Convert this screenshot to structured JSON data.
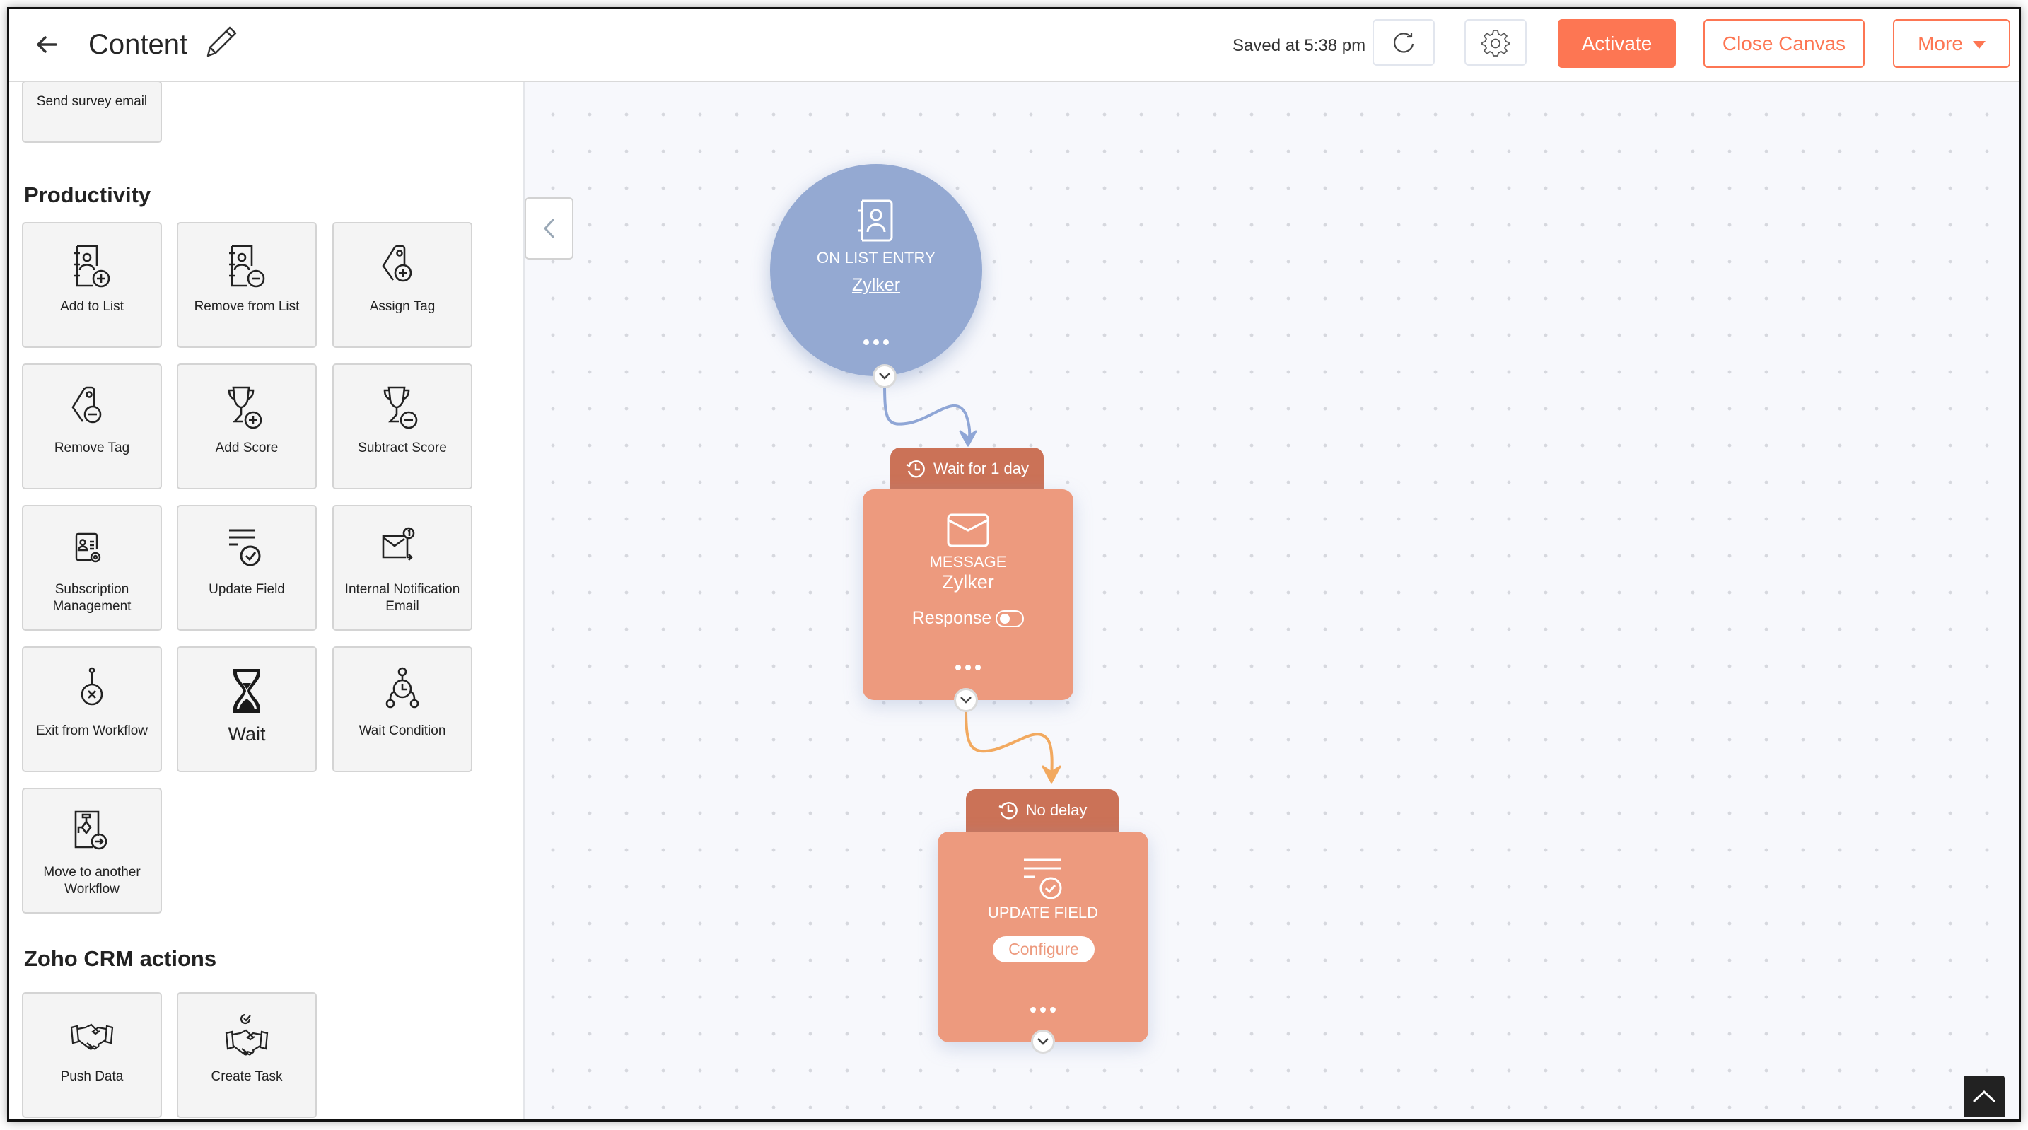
{
  "header": {
    "title": "Content",
    "saved_status": "Saved at 5:38 pm",
    "activate_label": "Activate",
    "close_canvas_label": "Close Canvas",
    "more_label": "More",
    "icons": {
      "back": "arrow-left-icon",
      "edit": "pencil-icon",
      "refresh": "refresh-icon",
      "settings": "gear-icon",
      "more_dropdown": "caret-down-icon"
    }
  },
  "sidebar": {
    "top_partial_tile": {
      "label": "Send survey email"
    },
    "sections": [
      {
        "title": "Productivity",
        "tiles": [
          {
            "label": "Add to List",
            "icon": "add-to-list-icon"
          },
          {
            "label": "Remove from List",
            "icon": "remove-from-list-icon"
          },
          {
            "label": "Assign Tag",
            "icon": "assign-tag-icon"
          },
          {
            "label": "Remove Tag",
            "icon": "remove-tag-icon"
          },
          {
            "label": "Add Score",
            "icon": "add-score-icon"
          },
          {
            "label": "Subtract Score",
            "icon": "subtract-score-icon"
          },
          {
            "label": "Subscription Management",
            "icon": "subscription-management-icon"
          },
          {
            "label": "Update Field",
            "icon": "update-field-icon"
          },
          {
            "label": "Internal Notification Email",
            "icon": "notification-email-icon"
          },
          {
            "label": "Exit from Workflow",
            "icon": "exit-workflow-icon"
          },
          {
            "label": "Wait",
            "icon": "hourglass-icon"
          },
          {
            "label": "Wait Condition",
            "icon": "wait-condition-icon"
          },
          {
            "label": "Move to another Workflow",
            "icon": "move-workflow-icon"
          }
        ]
      },
      {
        "title": "Zoho CRM actions",
        "tiles": [
          {
            "label": "Push Data",
            "icon": "handshake-icon"
          },
          {
            "label": "Create Task",
            "icon": "handshake-task-icon"
          }
        ]
      }
    ]
  },
  "canvas": {
    "collapse_icon": "chevron-left-icon",
    "nodes": {
      "entry": {
        "type_label": "ON LIST ENTRY",
        "list_name": "Zylker",
        "icon": "contact-book-icon",
        "color": "#94a9d2"
      },
      "message": {
        "delay_label": "Wait for 1 day",
        "type_label": "MESSAGE",
        "name": "Zylker",
        "response_label": "Response",
        "response_enabled": false,
        "icon": "envelope-icon",
        "color": "#ed9a7e"
      },
      "update_field": {
        "delay_label": "No delay",
        "type_label": "UPDATE FIELD",
        "configure_label": "Configure",
        "icon": "update-field-icon",
        "color": "#ed9a7e"
      }
    },
    "connector_colors": {
      "entry_to_message": "#8fa6d6",
      "message_to_update": "#f2a95f"
    },
    "scroll_top_icon": "chevron-up-icon"
  },
  "colors": {
    "accent": "#fd7653",
    "delay_tab": "#cb7257"
  }
}
